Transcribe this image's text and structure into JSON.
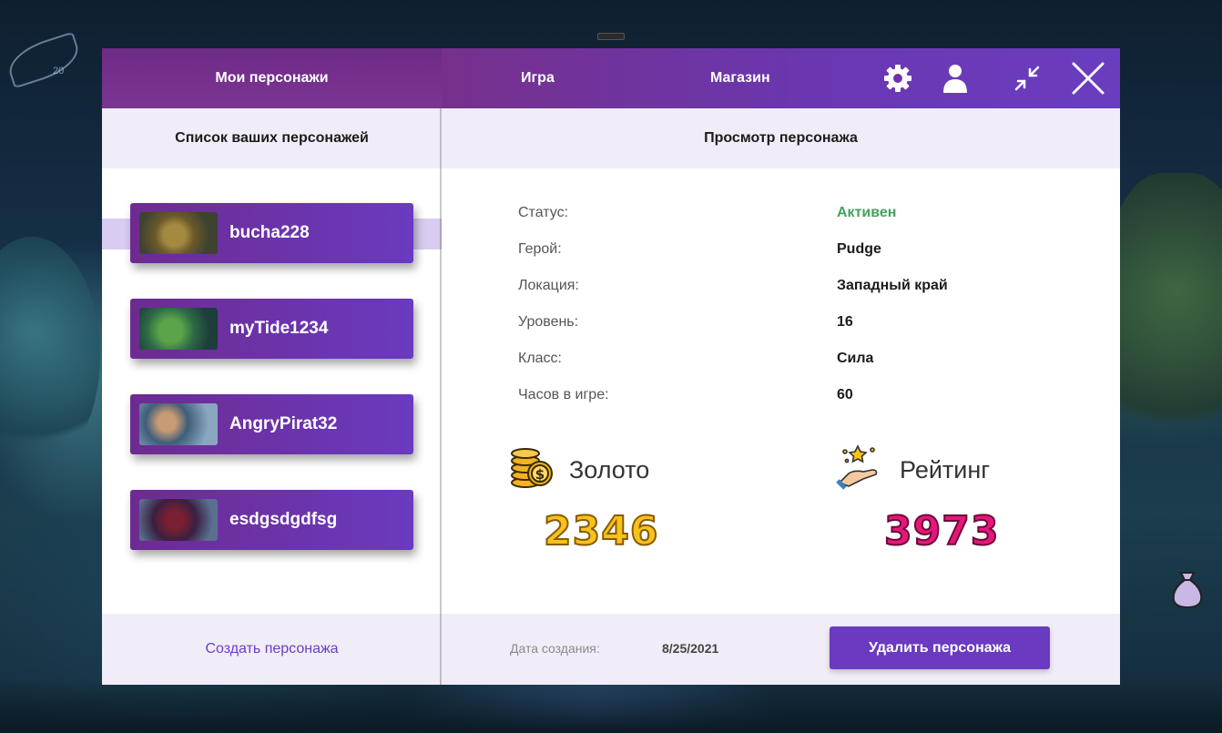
{
  "tabs": {
    "characters": "Мои персонажи",
    "game": "Игра",
    "shop": "Магазин"
  },
  "header_icons": [
    "gear-icon",
    "user-icon",
    "minimize-icon",
    "close-icon"
  ],
  "left_panel": {
    "subtitle": "Список ваших персонажей",
    "characters": [
      {
        "name": "bucha228",
        "avatar": "pudge-avatar",
        "selected": true
      },
      {
        "name": "myTide1234",
        "avatar": "tidehunter-avatar",
        "selected": false
      },
      {
        "name": "AngryPirat32",
        "avatar": "kunkka-avatar",
        "selected": false
      },
      {
        "name": "esdgsdgdfsg",
        "avatar": "queen-avatar",
        "selected": false
      }
    ],
    "create_label": "Создать персонажа"
  },
  "right_panel": {
    "subtitle": "Просмотр персонажа",
    "fields": [
      {
        "label": "Статус:",
        "value": "Активен"
      },
      {
        "label": "Герой:",
        "value": "Pudge"
      },
      {
        "label": "Локация:",
        "value": "Западный край"
      },
      {
        "label": "Уровень:",
        "value": "16"
      },
      {
        "label": "Класс:",
        "value": "Сила"
      },
      {
        "label": "Часов в игре:",
        "value": "60"
      }
    ],
    "gold": {
      "title": "Золото",
      "value": "2346",
      "icon": "coins-icon"
    },
    "rating": {
      "title": "Рейтинг",
      "value": "3973",
      "icon": "stars-hand-icon"
    },
    "bag_icon": "money-bag-icon",
    "footer": {
      "date_label": "Дата создания:",
      "date_value": "8/25/2021",
      "delete_label": "Удалить персонажа"
    }
  },
  "colors": {
    "accent": "#6a3ac0",
    "header_purple": "#76308c",
    "active_status": "#3ea55e",
    "gold": "#f6c21c",
    "rating": "#e6177a"
  }
}
